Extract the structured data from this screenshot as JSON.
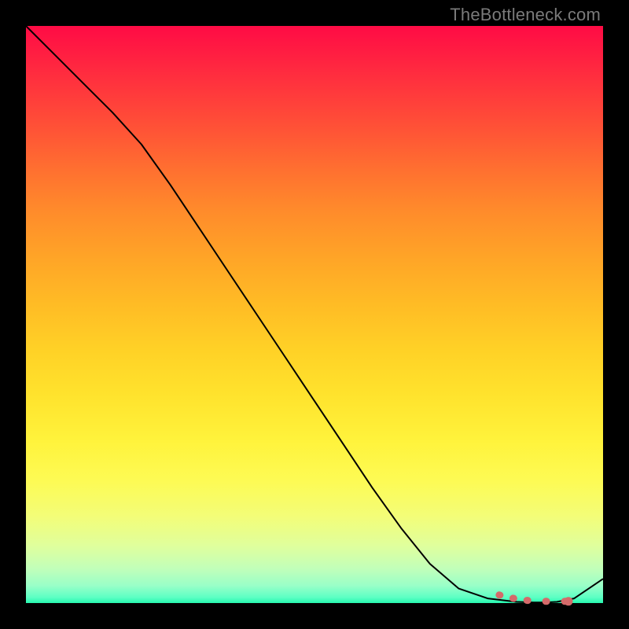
{
  "watermark": "TheBottleneck.com",
  "colors": {
    "gradient_top": "#ff0b45",
    "gradient_bottom": "#26f7ae",
    "curve": "#000000",
    "dotted": "#d46a6a",
    "frame": "#000000"
  },
  "chart_data": {
    "type": "line",
    "title": "",
    "xlabel": "",
    "ylabel": "",
    "xlim": [
      0,
      100
    ],
    "ylim": [
      0,
      100
    ],
    "grid": false,
    "annotations": [
      "TheBottleneck.com"
    ],
    "series": [
      {
        "name": "bottleneck-curve",
        "x": [
          0,
          5,
          10,
          15,
          20,
          25,
          30,
          35,
          40,
          45,
          50,
          55,
          60,
          65,
          70,
          75,
          80,
          85,
          88,
          90,
          92,
          95,
          100
        ],
        "y": [
          100,
          95,
          90,
          85,
          79.5,
          72.5,
          65,
          57.5,
          50,
          42.5,
          35,
          27.5,
          20,
          13,
          6.8,
          2.5,
          0.8,
          0.2,
          0.1,
          0.1,
          0.2,
          0.8,
          4.2
        ]
      },
      {
        "name": "optimal-range-marker",
        "x": [
          82,
          84,
          86,
          88,
          90,
          92,
          94
        ],
        "y": [
          1.4,
          0.9,
          0.55,
          0.35,
          0.3,
          0.3,
          0.3
        ]
      }
    ]
  }
}
